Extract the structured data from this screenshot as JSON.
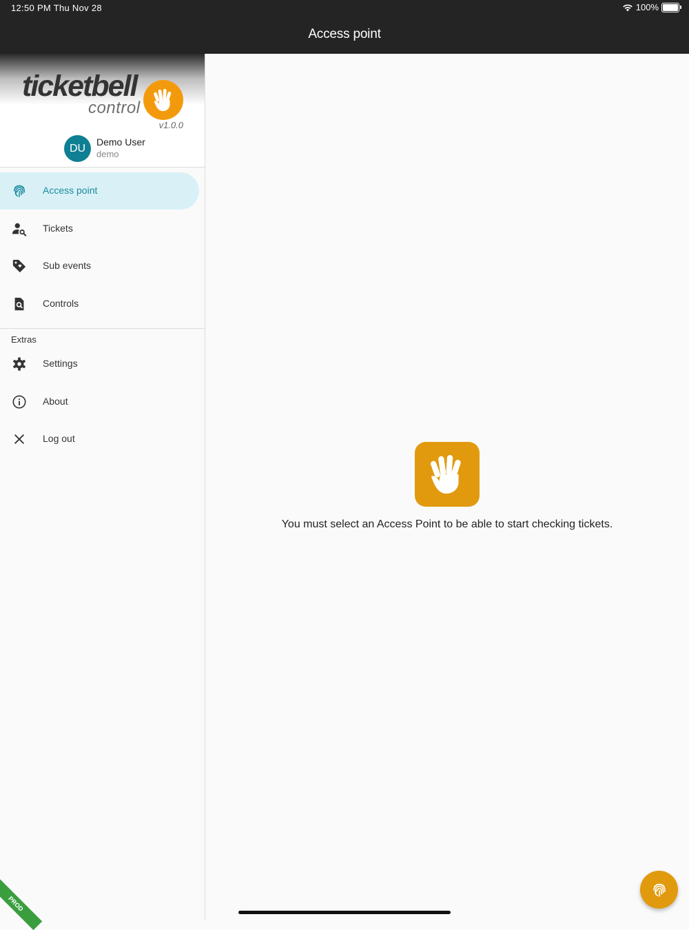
{
  "status_bar": {
    "time": "12:50 PM   Thu Nov 28",
    "battery": "100%"
  },
  "app_bar": {
    "title": "Access point"
  },
  "drawer": {
    "logo_word": "ticketbell",
    "logo_sub": "control",
    "version": "v1.0.0",
    "user": {
      "initials": "DU",
      "name": "Demo User",
      "login": "demo"
    },
    "items": [
      {
        "label": "Access point",
        "icon": "fingerprint-icon",
        "active": true
      },
      {
        "label": "Tickets",
        "icon": "person-search-icon"
      },
      {
        "label": "Sub events",
        "icon": "tag-icon"
      },
      {
        "label": "Controls",
        "icon": "document-search-icon"
      }
    ],
    "extras_label": "Extras",
    "extras": [
      {
        "label": "Settings",
        "icon": "gear-icon"
      },
      {
        "label": "About",
        "icon": "info-icon"
      },
      {
        "label": "Log out",
        "icon": "close-icon"
      }
    ],
    "ribbon": "PROD"
  },
  "main": {
    "message": "You must select an Access Point to be able to start checking tickets."
  },
  "colors": {
    "accent": "#e19a0e",
    "active_bg": "#d9f1f6",
    "active_text": "#1a8aa0",
    "avatar": "#0f7f93",
    "topbar": "#242424"
  }
}
